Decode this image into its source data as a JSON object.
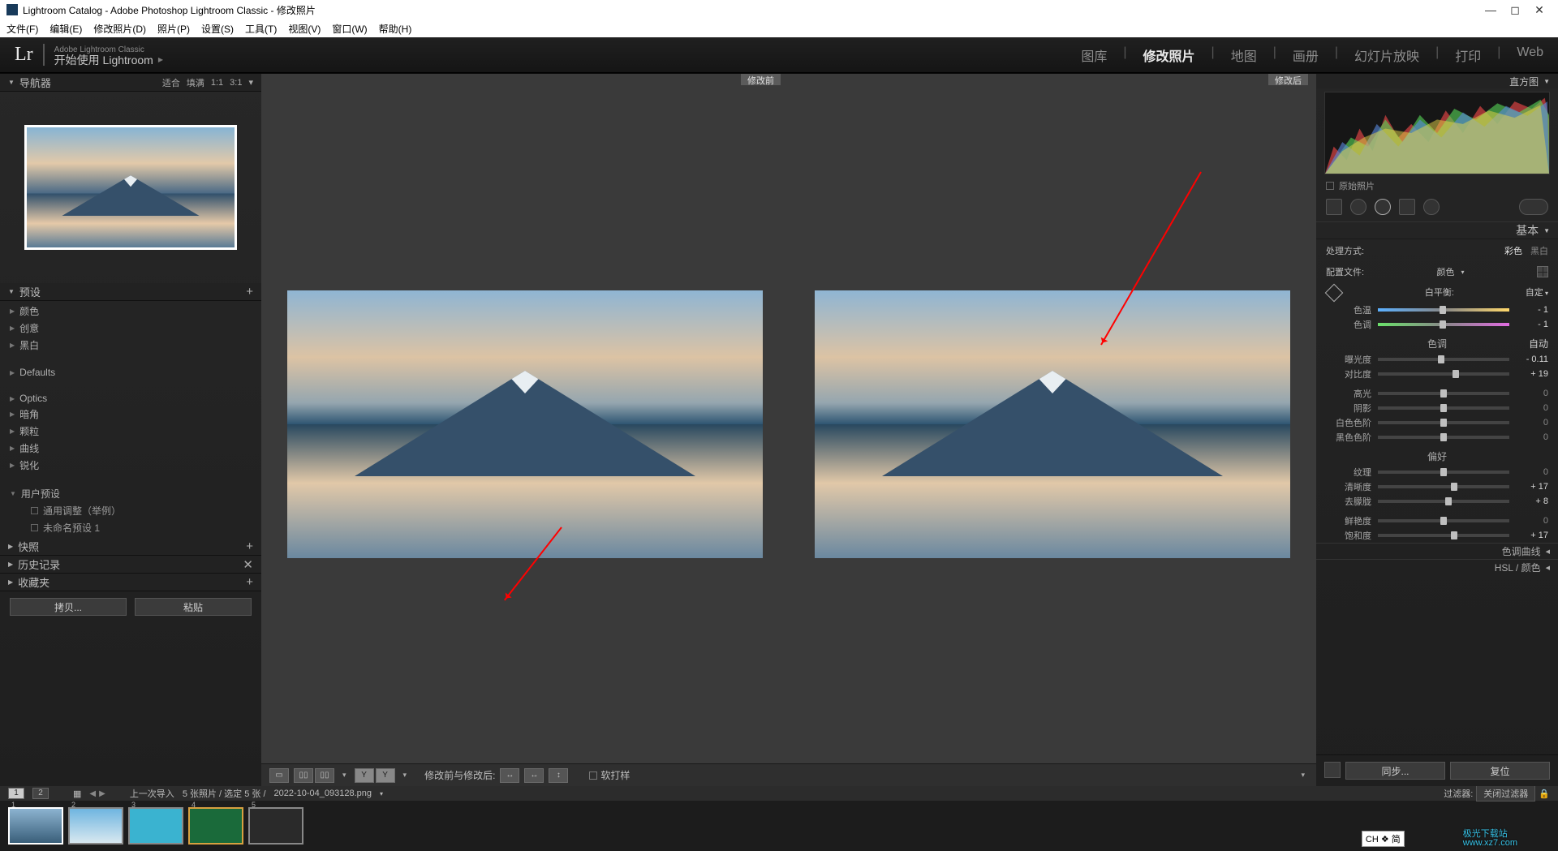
{
  "window": {
    "title": "Lightroom Catalog - Adobe Photoshop Lightroom Classic - 修改照片"
  },
  "menu": [
    "文件(F)",
    "编辑(E)",
    "修改照片(D)",
    "照片(P)",
    "设置(S)",
    "工具(T)",
    "视图(V)",
    "窗口(W)",
    "帮助(H)"
  ],
  "brand": {
    "small": "Adobe Lightroom Classic",
    "action": "开始使用 Lightroom"
  },
  "modules": [
    "图库",
    "修改照片",
    "地图",
    "画册",
    "幻灯片放映",
    "打印",
    "Web"
  ],
  "activeModule": "修改照片",
  "nav": {
    "title": "导航器",
    "fit": "适合",
    "fill": "填满",
    "r1": "1:1",
    "r3": "3:1"
  },
  "presets": {
    "title": "预设",
    "groups": [
      "颜色",
      "创意",
      "黑白"
    ],
    "defaults": "Defaults",
    "optics": "Optics",
    "more": [
      "暗角",
      "颗粒",
      "曲线",
      "锐化"
    ],
    "user": "用户预设",
    "userItems": [
      "通用调整（举例）",
      "未命名预设 1"
    ]
  },
  "leftSections": {
    "snapshot": "快照",
    "history": "历史记录",
    "collections": "收藏夹"
  },
  "leftBtns": {
    "copy": "拷贝...",
    "paste": "粘贴"
  },
  "compare": {
    "before": "修改前",
    "after": "修改后"
  },
  "toolbar": {
    "label": "修改前与修改后:",
    "soft": "软打样"
  },
  "right": {
    "histTitle": "直方图",
    "original": "原始照片",
    "basic": "基本",
    "treatment": {
      "label": "处理方式:",
      "color": "彩色",
      "bw": "黑白"
    },
    "profile": {
      "label": "配置文件:",
      "value": "颜色"
    },
    "wb": {
      "label": "白平衡:",
      "value": "自定"
    },
    "temp": {
      "label": "色温",
      "value": "- 1"
    },
    "tint": {
      "label": "色调",
      "value": "- 1"
    },
    "tone": {
      "header": "色调",
      "auto": "自动"
    },
    "exposure": {
      "label": "曝光度",
      "value": "- 0.11"
    },
    "contrast": {
      "label": "对比度",
      "value": "+ 19"
    },
    "highlights": {
      "label": "高光",
      "value": "0"
    },
    "shadows": {
      "label": "阴影",
      "value": "0"
    },
    "whites": {
      "label": "白色色阶",
      "value": "0"
    },
    "blacks": {
      "label": "黑色色阶",
      "value": "0"
    },
    "presence": "偏好",
    "texture": {
      "label": "纹理",
      "value": "0"
    },
    "clarity": {
      "label": "清晰度",
      "value": "+ 17"
    },
    "dehaze": {
      "label": "去朦胧",
      "value": "+ 8"
    },
    "vibrance": {
      "label": "鲜艳度",
      "value": "0"
    },
    "saturation": {
      "label": "饱和度",
      "value": "+ 17"
    },
    "toneCurve": "色调曲线",
    "hsl": "HSL / 颜色"
  },
  "rightBtns": {
    "sync": "同步...",
    "reset": "复位"
  },
  "film": {
    "lastImport": "上一次导入",
    "count": "5 张照片 / 选定 5 张 /",
    "filename": "2022-10-04_093128.png",
    "filter": "过滤器:",
    "filterOff": "关闭过滤器"
  },
  "ime": "CH ❖ 简",
  "watermark": {
    "l1": "极光下载站",
    "l2": "www.xz7.com"
  }
}
